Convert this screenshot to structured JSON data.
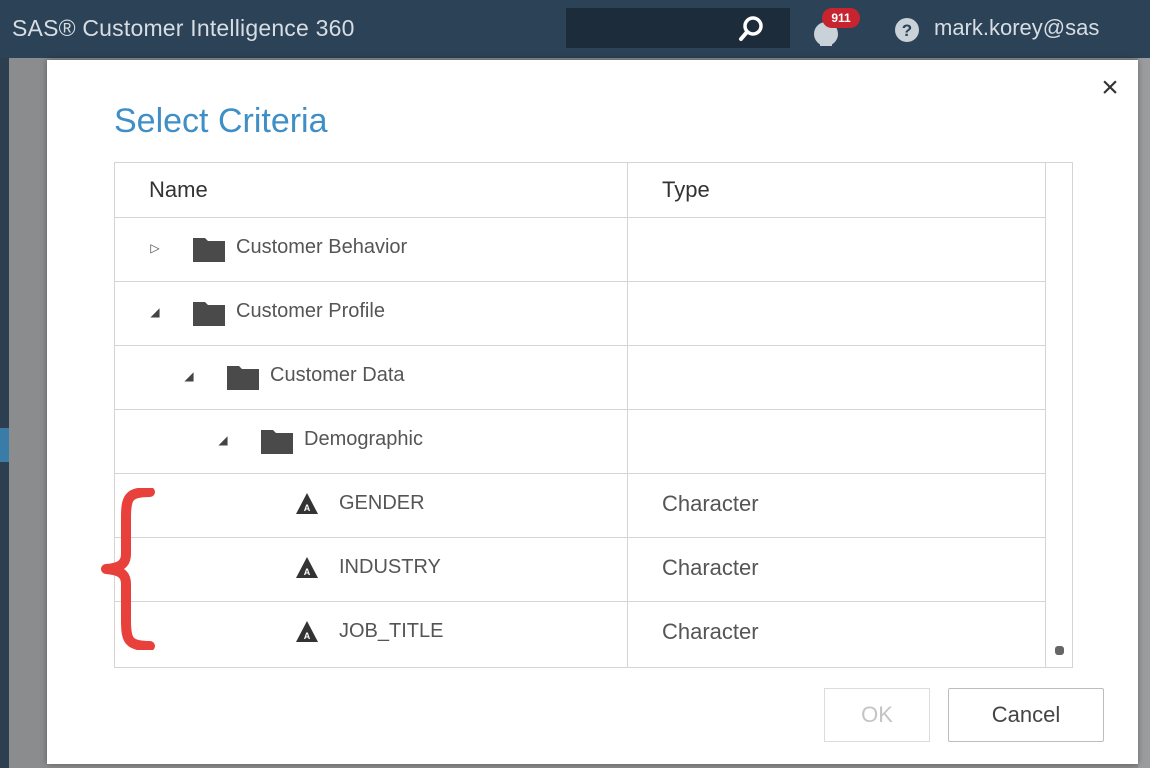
{
  "appbar": {
    "title": "SAS® Customer Intelligence 360",
    "notification_count": "911",
    "user": "mark.korey@sas"
  },
  "dialog": {
    "title": "Select Criteria",
    "close_symbol": "×",
    "columns": {
      "name": "Name",
      "type": "Type"
    },
    "rows": [
      {
        "label": "Customer Behavior",
        "type": "",
        "kind": "folder",
        "expander": "▷",
        "expanded": false
      },
      {
        "label": "Customer Profile",
        "type": "",
        "kind": "folder",
        "expander": "◢",
        "expanded": true
      },
      {
        "label": "Customer Data",
        "type": "",
        "kind": "folder",
        "expander": "◢",
        "expanded": true
      },
      {
        "label": "Demographic",
        "type": "",
        "kind": "folder",
        "expander": "◢",
        "expanded": true
      },
      {
        "label": "GENDER",
        "type": "Character",
        "kind": "character-variable"
      },
      {
        "label": "INDUSTRY",
        "type": "Character",
        "kind": "character-variable"
      },
      {
        "label": "JOB_TITLE",
        "type": "Character",
        "kind": "character-variable"
      }
    ],
    "ok_label": "OK",
    "cancel_label": "Cancel"
  },
  "icons": [
    "search-icon",
    "bell-icon",
    "help-icon",
    "close-icon",
    "folder-icon",
    "character-type-icon"
  ],
  "colors": {
    "appbar_bg": "#2b4257",
    "title_blue": "#3f8fc6",
    "badge_red": "#c8242f",
    "annotation_red": "#e8403a"
  }
}
